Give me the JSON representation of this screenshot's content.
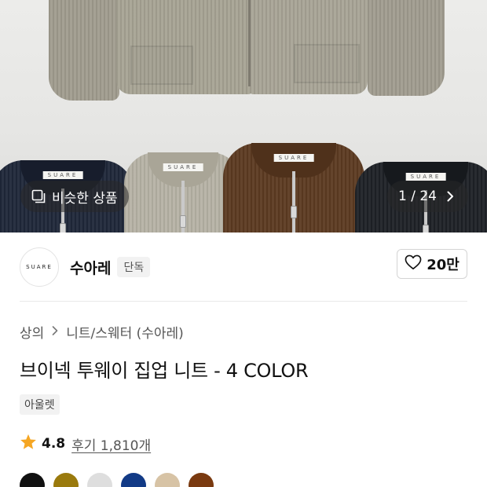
{
  "gallery": {
    "similar_label": "비슷한 상품",
    "page_indicator": "1 / 24",
    "tag_text": "SUARE"
  },
  "seller": {
    "logo_text": "SUARE",
    "name": "수아레",
    "badge": "단독",
    "like_count": "20만"
  },
  "product": {
    "breadcrumb": [
      "상의",
      "니트/스웨터 (수아레)"
    ],
    "title": "브이넥 투웨이 집업 니트 - 4 COLOR",
    "tag": "아울렛",
    "rating": "4.8",
    "reviews": "후기 1,810개"
  },
  "colors": {
    "star": "#f5a623",
    "swatches": [
      "#111111",
      "#9a7a0d",
      "#dedede",
      "#123a86",
      "#d7c3a5",
      "#7a3a10"
    ]
  },
  "icons": [
    "similar-items-icon",
    "chevron-right-icon",
    "heart-icon",
    "star-icon"
  ]
}
